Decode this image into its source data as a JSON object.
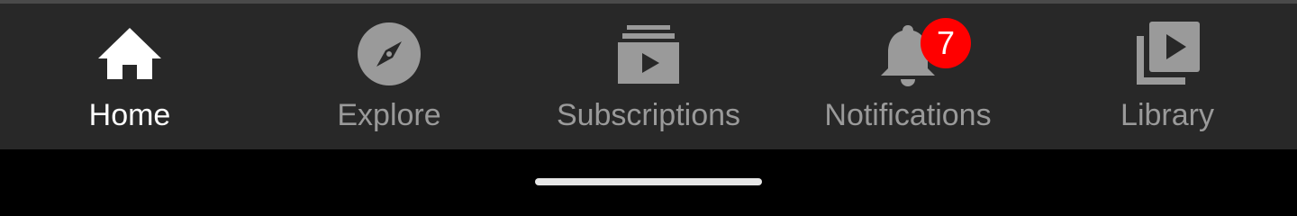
{
  "nav": {
    "tabs": [
      {
        "label": "Home",
        "icon": "home-icon",
        "active": true
      },
      {
        "label": "Explore",
        "icon": "compass-icon",
        "active": false
      },
      {
        "label": "Subscriptions",
        "icon": "subscriptions-icon",
        "active": false
      },
      {
        "label": "Notifications",
        "icon": "bell-icon",
        "active": false
      },
      {
        "label": "Library",
        "icon": "library-icon",
        "active": false
      }
    ],
    "notifications_badge": "7"
  },
  "colors": {
    "bar_background": "#282828",
    "active": "#ffffff",
    "inactive": "#9a9a9a",
    "badge": "#ff0000"
  }
}
